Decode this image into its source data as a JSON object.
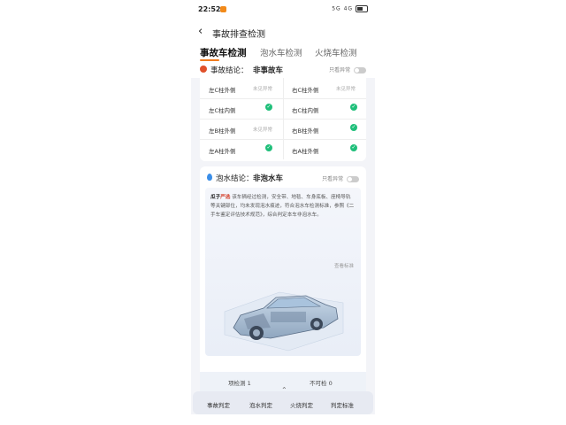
{
  "status_bar": {
    "time": "22:52",
    "right_text": "5G 4G"
  },
  "header": {
    "title": "事故排查检测"
  },
  "tabs": [
    {
      "label": "事故车检测"
    },
    {
      "label": "泡水车检测"
    },
    {
      "label": "火烧车检测"
    }
  ],
  "accident": {
    "label": "事故结论：",
    "value": "非事故车",
    "toggle_label": "只看异常",
    "rows": [
      {
        "left": "左C柱外侧",
        "left_status": "未见异常",
        "right": "右C柱外侧",
        "right_status": "未见异常"
      },
      {
        "left": "左C柱内侧",
        "right": "右C柱内侧"
      },
      {
        "left": "左B柱外侧",
        "left_status": "未见异常",
        "right": "右B柱外侧"
      },
      {
        "left": "左A柱外侧",
        "right": "右A柱外侧"
      }
    ]
  },
  "flood": {
    "label": "泡水结论：",
    "value": "非泡水车",
    "toggle_label": "只看异常",
    "brand": "瓜子",
    "brand_suffix": "严选",
    "description": "该车辆经过检测，安全带、地毯、车身底板、座椅导轨等关键部位，均未发现泡水痕迹，符合泡水车检测标准，参照《二手车鉴定评估技术规范》，综合判定本车非泡水车。",
    "tag": "查看标准",
    "stats": {
      "checked": "项检测 1",
      "abnormal": "不可检 0"
    }
  },
  "bottom_nav": [
    {
      "label": "事故判定"
    },
    {
      "label": "泡水判定"
    },
    {
      "label": "火烧判定"
    },
    {
      "label": "判定标准"
    }
  ],
  "colors": {
    "accent": "#f07b1e",
    "check": "#1fbf7a",
    "danger": "#d4402b"
  }
}
